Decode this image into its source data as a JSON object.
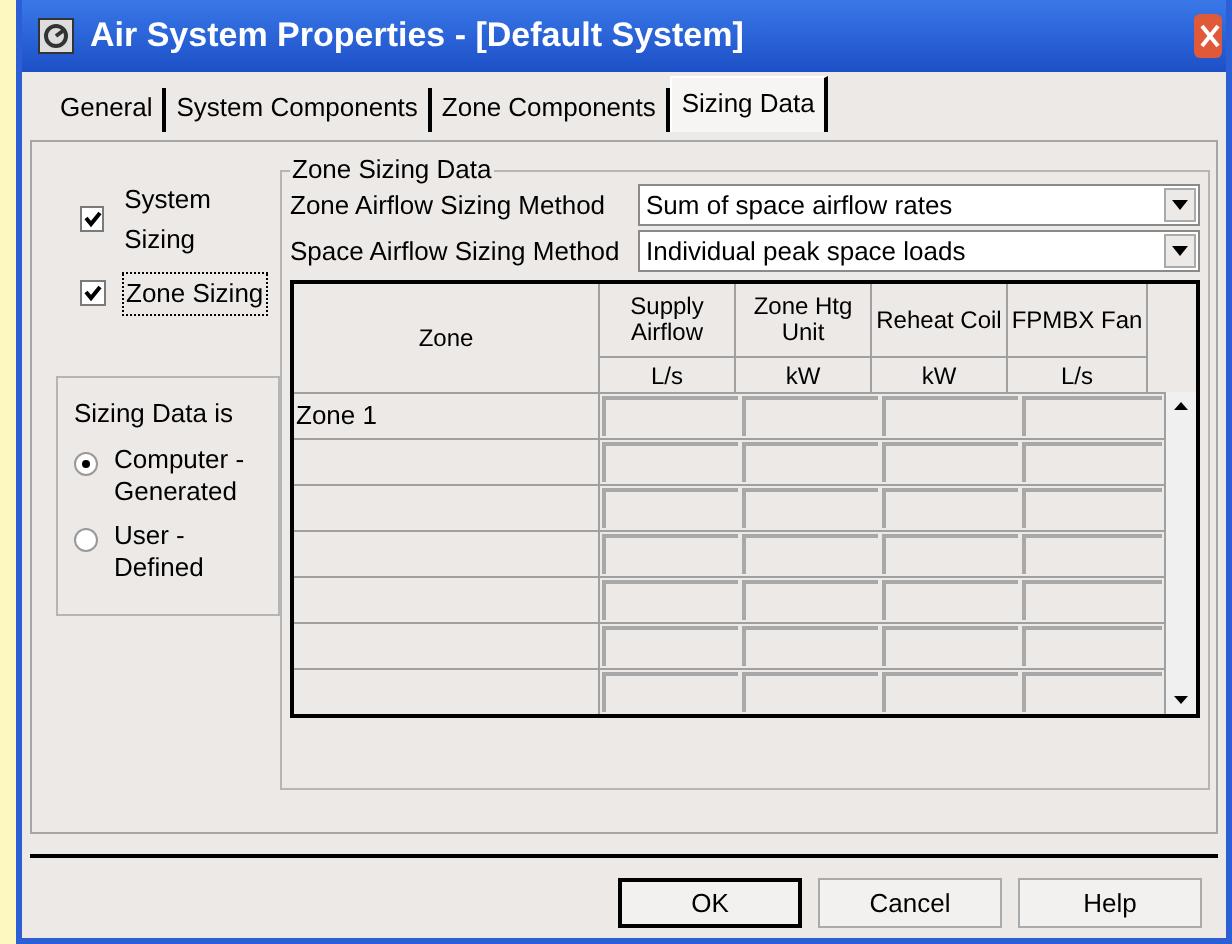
{
  "window": {
    "title": "Air System Properties - [Default System]"
  },
  "tabs": [
    {
      "label": "General",
      "selected": false
    },
    {
      "label": "System Components",
      "selected": false
    },
    {
      "label": "Zone Components",
      "selected": false
    },
    {
      "label": "Sizing Data",
      "selected": true
    }
  ],
  "sizing_options": [
    {
      "label": "System Sizing",
      "checked": true,
      "focused": false
    },
    {
      "label": "Zone Sizing",
      "checked": true,
      "focused": true
    }
  ],
  "sizing_source": {
    "title": "Sizing Data is",
    "options": [
      {
        "label": "Computer - Generated",
        "selected": true
      },
      {
        "label": "User - Defined",
        "selected": false
      }
    ]
  },
  "zone_sizing": {
    "title": "Zone Sizing Data",
    "fields": [
      {
        "label": "Zone Airflow Sizing Method",
        "value": "Sum of space airflow rates"
      },
      {
        "label": "Space Airflow Sizing Method",
        "value": "Individual peak space loads"
      }
    ],
    "table": {
      "columns": [
        {
          "label": "Zone"
        },
        {
          "label": "Supply Airflow",
          "unit": "L/s"
        },
        {
          "label": "Zone Htg Unit",
          "unit": "kW"
        },
        {
          "label": "Reheat Coil",
          "unit": "kW"
        },
        {
          "label": "FPMBX Fan",
          "unit": "L/s"
        }
      ],
      "rows": [
        {
          "zone": "Zone 1"
        }
      ]
    }
  },
  "buttons": [
    {
      "label": "OK",
      "default": true
    },
    {
      "label": "Cancel",
      "default": false
    },
    {
      "label": "Help",
      "default": false
    }
  ]
}
